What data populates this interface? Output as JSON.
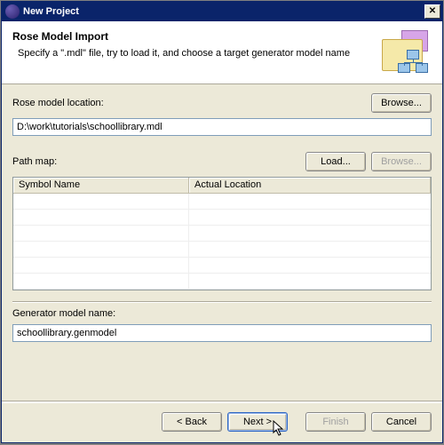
{
  "window": {
    "title": "New Project"
  },
  "header": {
    "title": "Rose Model Import",
    "subtitle": "Specify a \".mdl\" file, try to load it, and choose a target generator model name"
  },
  "labels": {
    "rose_location": "Rose model location:",
    "path_map": "Path map:",
    "generator_name": "Generator model name:"
  },
  "buttons": {
    "browse": "Browse...",
    "load": "Load...",
    "browse2": "Browse...",
    "back": "< Back",
    "next": "Next >",
    "finish": "Finish",
    "cancel": "Cancel"
  },
  "inputs": {
    "rose_location_value": "D:\\work\\tutorials\\schoollibrary.mdl",
    "generator_name_value": "schoollibrary.genmodel"
  },
  "table": {
    "columns": [
      "Symbol Name",
      "Actual Location"
    ],
    "rows": [
      {
        "symbol": "",
        "location": ""
      },
      {
        "symbol": "",
        "location": ""
      },
      {
        "symbol": "",
        "location": ""
      },
      {
        "symbol": "",
        "location": ""
      },
      {
        "symbol": "",
        "location": ""
      },
      {
        "symbol": "",
        "location": ""
      }
    ]
  }
}
